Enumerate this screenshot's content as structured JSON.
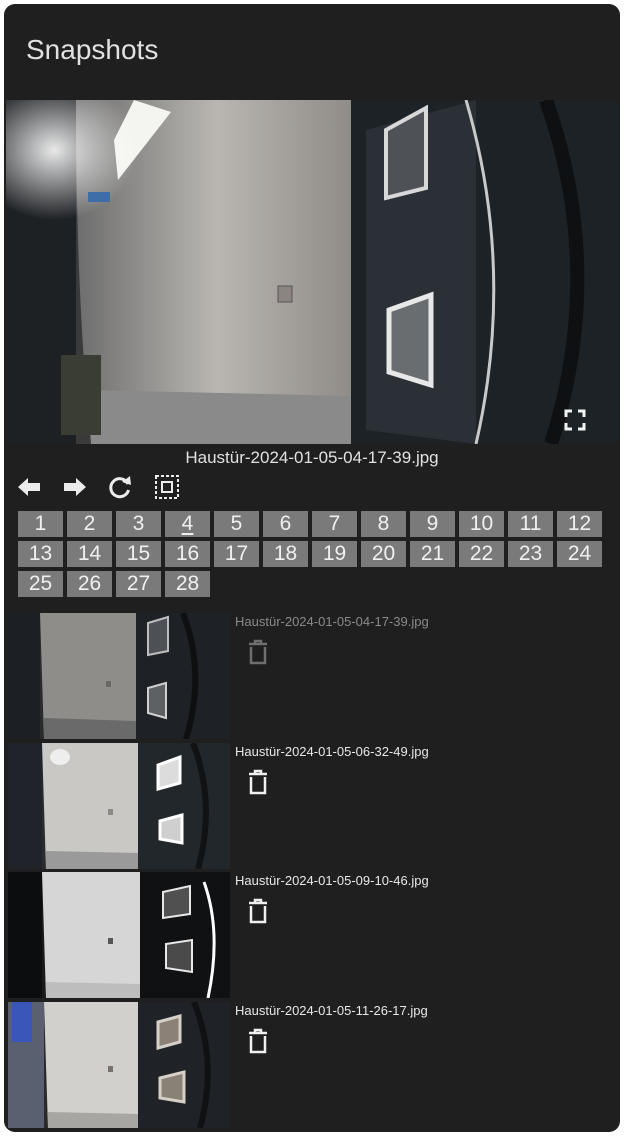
{
  "card": {
    "title": "Snapshots"
  },
  "viewer": {
    "filename": "Haustür-2024-01-05-04-17-39.jpg",
    "controls": [
      "arrow-left-icon",
      "arrow-right-icon",
      "refresh-icon",
      "select-icon"
    ],
    "fullscreen_icon": "fullscreen-icon"
  },
  "pagination": {
    "pages": [
      "1",
      "2",
      "3",
      "4",
      "5",
      "6",
      "7",
      "8",
      "9",
      "10",
      "11",
      "12",
      "13",
      "14",
      "15",
      "16",
      "17",
      "18",
      "19",
      "20",
      "21",
      "22",
      "23",
      "24",
      "25",
      "26",
      "27",
      "28"
    ],
    "current": "4"
  },
  "snapshots": [
    {
      "filename": "Haustür-2024-01-05-04-17-39.jpg",
      "active": false
    },
    {
      "filename": "Haustür-2024-01-05-06-32-49.jpg",
      "active": true
    },
    {
      "filename": "Haustür-2024-01-05-09-10-46.jpg",
      "active": true
    },
    {
      "filename": "Haustür-2024-01-05-11-26-17.jpg",
      "active": true
    }
  ],
  "colors": {
    "card_bg": "#1f1f1f",
    "page_button": "#7a7a7a",
    "text": "#e1e1e1"
  }
}
